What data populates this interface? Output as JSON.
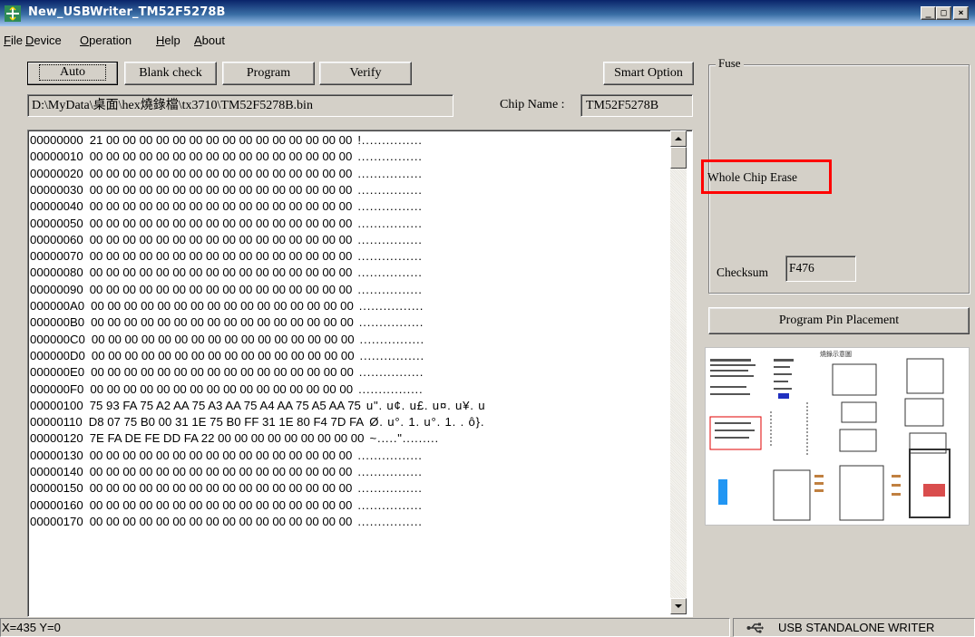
{
  "window": {
    "title": "New_USBWriter_TM52F5278B",
    "controls": {
      "minimize": "_",
      "maximize": "□",
      "close": "×"
    }
  },
  "menu": [
    {
      "label": "File",
      "mnemonic": "F",
      "rest": "ile"
    },
    {
      "label": "Device",
      "mnemonic": "D",
      "rest": "evice"
    },
    {
      "label": "Operation",
      "mnemonic": "O",
      "rest": "peration"
    },
    {
      "label": "Help",
      "mnemonic": "H",
      "rest": "elp"
    },
    {
      "label": "About",
      "mnemonic": "A",
      "rest": "bout"
    }
  ],
  "toolbar": {
    "auto": "Auto",
    "blank_check": "Blank check",
    "program": "Program",
    "verify": "Verify",
    "smart_option": "Smart Option"
  },
  "file_path": "D:\\MyData\\桌面\\hex燒錄檔\\tx3710\\TM52F5278B.bin",
  "chip": {
    "label": "Chip Name :",
    "value": "TM52F5278B"
  },
  "hex_rows": [
    {
      "addr": "00000000",
      "bytes": "21 00 00 00 00 00 00 00 00 00 00 00 00 00 00 00",
      "ascii": "!..............."
    },
    {
      "addr": "00000010",
      "bytes": "00 00 00 00 00 00 00 00 00 00 00 00 00 00 00 00",
      "ascii": "................"
    },
    {
      "addr": "00000020",
      "bytes": "00 00 00 00 00 00 00 00 00 00 00 00 00 00 00 00",
      "ascii": "................"
    },
    {
      "addr": "00000030",
      "bytes": "00 00 00 00 00 00 00 00 00 00 00 00 00 00 00 00",
      "ascii": "................"
    },
    {
      "addr": "00000040",
      "bytes": "00 00 00 00 00 00 00 00 00 00 00 00 00 00 00 00",
      "ascii": "................"
    },
    {
      "addr": "00000050",
      "bytes": "00 00 00 00 00 00 00 00 00 00 00 00 00 00 00 00",
      "ascii": "................"
    },
    {
      "addr": "00000060",
      "bytes": "00 00 00 00 00 00 00 00 00 00 00 00 00 00 00 00",
      "ascii": "................"
    },
    {
      "addr": "00000070",
      "bytes": "00 00 00 00 00 00 00 00 00 00 00 00 00 00 00 00",
      "ascii": "................"
    },
    {
      "addr": "00000080",
      "bytes": "00 00 00 00 00 00 00 00 00 00 00 00 00 00 00 00",
      "ascii": "................"
    },
    {
      "addr": "00000090",
      "bytes": "00 00 00 00 00 00 00 00 00 00 00 00 00 00 00 00",
      "ascii": "................"
    },
    {
      "addr": "000000A0",
      "bytes": "00 00 00 00 00 00 00 00 00 00 00 00 00 00 00 00",
      "ascii": "................"
    },
    {
      "addr": "000000B0",
      "bytes": "00 00 00 00 00 00 00 00 00 00 00 00 00 00 00 00",
      "ascii": "................"
    },
    {
      "addr": "000000C0",
      "bytes": "00 00 00 00 00 00 00 00 00 00 00 00 00 00 00 00",
      "ascii": "................"
    },
    {
      "addr": "000000D0",
      "bytes": "00 00 00 00 00 00 00 00 00 00 00 00 00 00 00 00",
      "ascii": "................"
    },
    {
      "addr": "000000E0",
      "bytes": "00 00 00 00 00 00 00 00 00 00 00 00 00 00 00 00",
      "ascii": "................"
    },
    {
      "addr": "000000F0",
      "bytes": "00 00 00 00 00 00 00 00 00 00 00 00 00 00 00 00",
      "ascii": "................"
    },
    {
      "addr": "00000100",
      "bytes": "75 93 FA 75 A2 AA 75 A3 AA 75 A4 AA 75 A5 AA 75",
      "ascii": "u\". u¢. u£. u¤. u¥. u"
    },
    {
      "addr": "00000110",
      "bytes": "D8 07 75 B0 00 31 1E 75 B0 FF 31 1E 80 F4 7D FA",
      "ascii": "Ø. u°. 1. u°. 1. . ô}."
    },
    {
      "addr": "00000120",
      "bytes": "7E FA DE FE DD FA 22 00 00 00 00 00 00 00 00 00",
      "ascii": "~.....\"........."
    },
    {
      "addr": "00000130",
      "bytes": "00 00 00 00 00 00 00 00 00 00 00 00 00 00 00 00",
      "ascii": "................"
    },
    {
      "addr": "00000140",
      "bytes": "00 00 00 00 00 00 00 00 00 00 00 00 00 00 00 00",
      "ascii": "................"
    },
    {
      "addr": "00000150",
      "bytes": "00 00 00 00 00 00 00 00 00 00 00 00 00 00 00 00",
      "ascii": "................"
    },
    {
      "addr": "00000160",
      "bytes": "00 00 00 00 00 00 00 00 00 00 00 00 00 00 00 00",
      "ascii": "................"
    },
    {
      "addr": "00000170",
      "bytes": "00 00 00 00 00 00 00 00 00 00 00 00 00 00 00 00",
      "ascii": "................"
    }
  ],
  "fuse": {
    "label": "Fuse",
    "erase_mode": "Whole Chip Erase",
    "checksum_label": "Checksum",
    "checksum_value": "F476"
  },
  "pin_placement_button": "Program Pin Placement",
  "pin_diagram_caption": "燒錄示意圖",
  "statusbar": {
    "coords": "X=435 Y=0",
    "device": "USB STANDALONE WRITER",
    "icon": "usb-icon"
  },
  "colors": {
    "highlight_border": "#ff0000",
    "title_gradient_start": "#0a246a",
    "title_gradient_end": "#a6caf0"
  }
}
